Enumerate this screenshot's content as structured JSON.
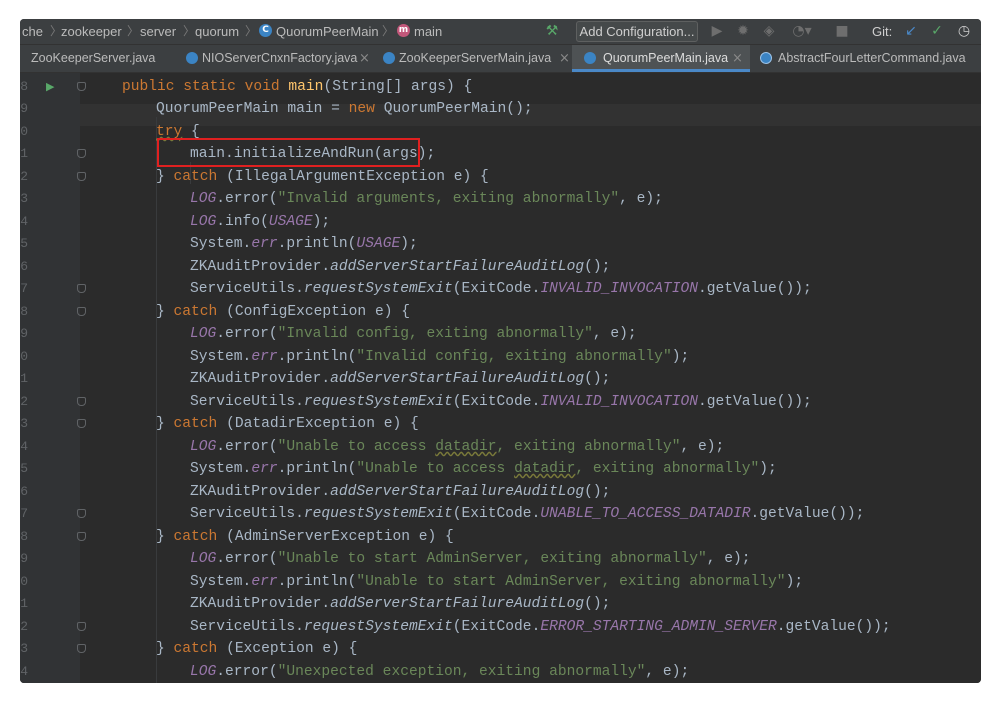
{
  "navbar": {
    "breadcrumbs": [
      "che",
      "zookeeper",
      "server",
      "quorum",
      "QuorumPeerMain",
      "main"
    ],
    "add_configuration": "Add Configuration...",
    "git_label": "Git:"
  },
  "tabs": [
    {
      "label": "ZooKeeperServer.java",
      "active": false
    },
    {
      "label": "NIOServerCnxnFactory.java",
      "active": false
    },
    {
      "label": "ZooKeeperServerMain.java",
      "active": false
    },
    {
      "label": "QuorumPeerMain.java",
      "active": true
    },
    {
      "label": "AbstractFourLetterCommand.java",
      "active": false
    }
  ],
  "line_numbers": [
    "8",
    "9",
    "0",
    "1",
    "2",
    "3",
    "4",
    "5",
    "6",
    "7",
    "8",
    "9",
    "0",
    "1",
    "2",
    "3",
    "4",
    "5",
    "6",
    "7",
    "8",
    "9",
    "0",
    "1",
    "2",
    "3",
    "4"
  ],
  "code": {
    "l0_a": "public static void ",
    "l0_b": "main",
    "l0_c": "(String[] args) {",
    "l1_a": "QuorumPeerMain main = ",
    "l1_b": "new ",
    "l1_c": "QuorumPeerMain();",
    "l2_a": "try",
    "l2_b": " {",
    "l3": "main.initializeAndRun(args);",
    "l4_a": "} ",
    "l4_b": "catch",
    "l4_c": " (IllegalArgumentException e) {",
    "l5_a": "LOG",
    "l5_b": ".error(",
    "l5_c": "\"Invalid arguments, exiting abnormally\"",
    "l5_d": ", e);",
    "l6_a": "LOG",
    "l6_b": ".info(",
    "l6_c": "USAGE",
    "l6_d": ");",
    "l7_a": "System.",
    "l7_b": "err",
    "l7_c": ".println(",
    "l7_d": "USAGE",
    "l7_e": ");",
    "l8_a": "ZKAuditProvider.",
    "l8_b": "addServerStartFailureAuditLog",
    "l8_c": "();",
    "l9_a": "ServiceUtils.",
    "l9_b": "requestSystemExit",
    "l9_c": "(ExitCode.",
    "l9_d": "INVALID_INVOCATION",
    "l9_e": ".getValue());",
    "l10_a": "} ",
    "l10_b": "catch",
    "l10_c": " (ConfigException e) {",
    "l11_a": "LOG",
    "l11_b": ".error(",
    "l11_c": "\"Invalid config, exiting abnormally\"",
    "l11_d": ", e);",
    "l12_a": "System.",
    "l12_b": "err",
    "l12_c": ".println(",
    "l12_d": "\"Invalid config, exiting abnormally\"",
    "l12_e": ");",
    "l13_a": "ZKAuditProvider.",
    "l13_b": "addServerStartFailureAuditLog",
    "l13_c": "();",
    "l14_a": "ServiceUtils.",
    "l14_b": "requestSystemExit",
    "l14_c": "(ExitCode.",
    "l14_d": "INVALID_INVOCATION",
    "l14_e": ".getValue());",
    "l15_a": "} ",
    "l15_b": "catch",
    "l15_c": " (DatadirException e) {",
    "l16_a": "LOG",
    "l16_b": ".error(",
    "l16_c1": "\"Unable to access ",
    "l16_c2": "datadir",
    "l16_c3": ", exiting abnormally\"",
    "l16_d": ", e);",
    "l17_a": "System.",
    "l17_b": "err",
    "l17_c": ".println(",
    "l17_d1": "\"Unable to access ",
    "l17_d2": "datadir",
    "l17_d3": ", exiting abnormally\"",
    "l17_e": ");",
    "l18_a": "ZKAuditProvider.",
    "l18_b": "addServerStartFailureAuditLog",
    "l18_c": "();",
    "l19_a": "ServiceUtils.",
    "l19_b": "requestSystemExit",
    "l19_c": "(ExitCode.",
    "l19_d": "UNABLE_TO_ACCESS_DATADIR",
    "l19_e": ".getValue());",
    "l20_a": "} ",
    "l20_b": "catch",
    "l20_c": " (AdminServerException e) {",
    "l21_a": "LOG",
    "l21_b": ".error(",
    "l21_c": "\"Unable to start AdminServer, exiting abnormally\"",
    "l21_d": ", e);",
    "l22_a": "System.",
    "l22_b": "err",
    "l22_c": ".println(",
    "l22_d": "\"Unable to start AdminServer, exiting abnormally\"",
    "l22_e": ");",
    "l23_a": "ZKAuditProvider.",
    "l23_b": "addServerStartFailureAuditLog",
    "l23_c": "();",
    "l24_a": "ServiceUtils.",
    "l24_b": "requestSystemExit",
    "l24_c": "(ExitCode.",
    "l24_d": "ERROR_STARTING_ADMIN_SERVER",
    "l24_e": ".getValue());",
    "l25_a": "} ",
    "l25_b": "catch",
    "l25_c": " (Exception e) {",
    "l26_a": "LOG",
    "l26_b": ".error(",
    "l26_c": "\"Unexpected exception, exiting abnormally\"",
    "l26_d": ", e);"
  },
  "colors": {
    "keyword": "#cc7832",
    "method_decl": "#ffc66d",
    "string": "#6a8759",
    "field": "#9876aa",
    "text": "#a9b7c6",
    "highlight_box": "#e02020"
  }
}
